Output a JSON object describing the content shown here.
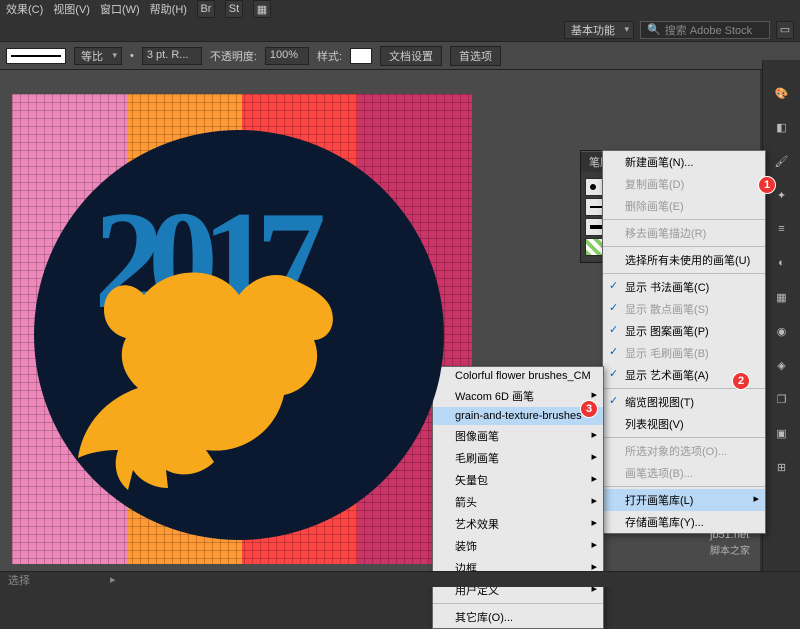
{
  "menubar": [
    "效果(C)",
    "视图(V)",
    "窗口(W)",
    "帮助(H)"
  ],
  "topbar": {
    "workspace": "基本功能",
    "searchPlaceholder": "搜索 Adobe Stock"
  },
  "optbar": {
    "uniform": "等比",
    "stroke": "3 pt. R...",
    "opacityLabel": "不透明度:",
    "opacity": "100%",
    "styleLabel": "样式:",
    "docSetup": "文档设置",
    "prefs": "首选项"
  },
  "panel": {
    "tab": "笔刷"
  },
  "menu1": [
    {
      "t": "新建画笔(N)...",
      "e": true
    },
    {
      "t": "复制画笔(D)",
      "e": false
    },
    {
      "t": "删除画笔(E)",
      "e": false
    },
    {
      "sep": true
    },
    {
      "t": "移去画笔描边(R)",
      "e": false
    },
    {
      "sep": true
    },
    {
      "t": "选择所有未使用的画笔(U)",
      "e": true
    },
    {
      "sep": true
    },
    {
      "t": "显示 书法画笔(C)",
      "e": true,
      "c": true
    },
    {
      "t": "显示 散点画笔(S)",
      "e": false,
      "c": true
    },
    {
      "t": "显示 图案画笔(P)",
      "e": true,
      "c": true
    },
    {
      "t": "显示 毛刷画笔(B)",
      "e": false,
      "c": true
    },
    {
      "t": "显示 艺术画笔(A)",
      "e": true,
      "c": true
    },
    {
      "sep": true
    },
    {
      "t": "缩览图视图(T)",
      "e": true,
      "c": true
    },
    {
      "t": "列表视图(V)",
      "e": true
    },
    {
      "sep": true
    },
    {
      "t": "所选对象的选项(O)...",
      "e": false
    },
    {
      "t": "画笔选项(B)...",
      "e": false
    },
    {
      "sep": true
    },
    {
      "t": "打开画笔库(L)",
      "e": true,
      "hl": true,
      "arrow": true
    },
    {
      "t": "存储画笔库(Y)...",
      "e": true
    }
  ],
  "menu2": [
    {
      "t": "Colorful flower brushes_CM"
    },
    {
      "t": "Wacom 6D 画笔",
      "arrow": true
    },
    {
      "t": "grain-and-texture-brushes",
      "hl": true
    },
    {
      "t": "图像画笔",
      "arrow": true
    },
    {
      "t": "毛刷画笔",
      "arrow": true
    },
    {
      "t": "矢量包",
      "arrow": true
    },
    {
      "t": "箭头",
      "arrow": true
    },
    {
      "t": "艺术效果",
      "arrow": true
    },
    {
      "t": "装饰",
      "arrow": true
    },
    {
      "t": "边框",
      "arrow": true
    },
    {
      "t": "用户定义",
      "arrow": true
    },
    {
      "sep": true
    },
    {
      "t": "其它库(O)..."
    }
  ],
  "badges": {
    "b1": "1",
    "b2": "2",
    "b3": "3"
  },
  "watermark": "jb51.net",
  "statusbar": "选择"
}
